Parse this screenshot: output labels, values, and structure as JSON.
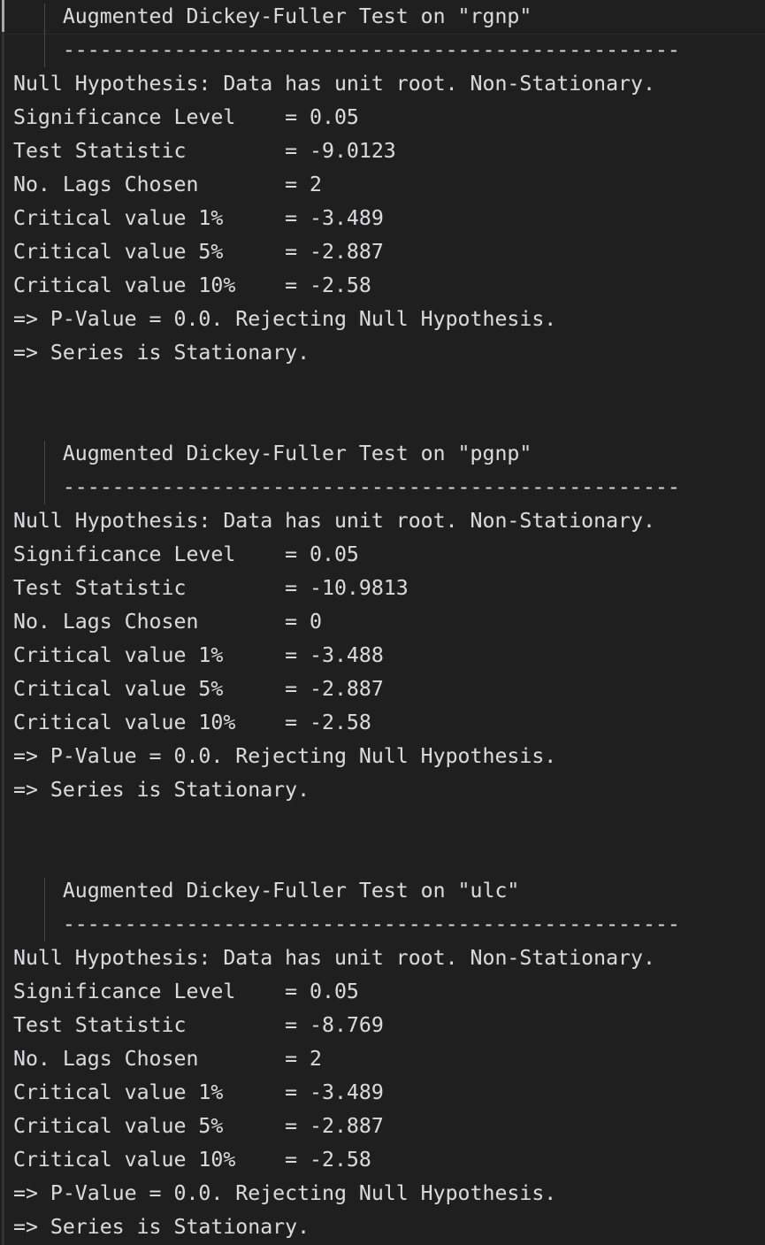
{
  "terminal": {
    "background_color": "#1f1f1f",
    "text_color": "#d9d9d9",
    "gutter_color": "#343434",
    "scrollbar_thumb_color": "#a9a9a9",
    "indent_guide_color": "#4a4a4a",
    "separator_color": "#2b2b2b",
    "divider": "    --------------------------------------------------"
  },
  "tests": [
    {
      "title": "    Augmented Dickey-Fuller Test on \"rgnp\"",
      "divider": "    --------------------------------------------------",
      "null_hypothesis": "Null Hypothesis: Data has unit root. Non-Stationary.",
      "significance_level": "Significance Level    = 0.05",
      "test_statistic": "Test Statistic        = -9.0123",
      "no_lags_chosen": "No. Lags Chosen       = 2",
      "critical_value_1": "Critical value 1%     = -3.489",
      "critical_value_5": "Critical value 5%     = -2.887",
      "critical_value_10": "Critical value 10%    = -2.58",
      "p_value": "=> P-Value = 0.0. Rejecting Null Hypothesis.",
      "conclusion": "=> Series is Stationary."
    },
    {
      "title": "    Augmented Dickey-Fuller Test on \"pgnp\"",
      "divider": "    --------------------------------------------------",
      "null_hypothesis": "Null Hypothesis: Data has unit root. Non-Stationary.",
      "significance_level": "Significance Level    = 0.05",
      "test_statistic": "Test Statistic        = -10.9813",
      "no_lags_chosen": "No. Lags Chosen       = 0",
      "critical_value_1": "Critical value 1%     = -3.488",
      "critical_value_5": "Critical value 5%     = -2.887",
      "critical_value_10": "Critical value 10%    = -2.58",
      "p_value": "=> P-Value = 0.0. Rejecting Null Hypothesis.",
      "conclusion": "=> Series is Stationary."
    },
    {
      "title": "    Augmented Dickey-Fuller Test on \"ulc\"",
      "divider": "    --------------------------------------------------",
      "null_hypothesis": "Null Hypothesis: Data has unit root. Non-Stationary.",
      "significance_level": "Significance Level    = 0.05",
      "test_statistic": "Test Statistic        = -8.769",
      "no_lags_chosen": "No. Lags Chosen       = 2",
      "critical_value_1": "Critical value 1%     = -3.489",
      "critical_value_5": "Critical value 5%     = -2.887",
      "critical_value_10": "Critical value 10%    = -2.58",
      "p_value": "=> P-Value = 0.0. Rejecting Null Hypothesis.",
      "conclusion": "=> Series is Stationary."
    }
  ],
  "lines": [
    "    Augmented Dickey-Fuller Test on \"rgnp\"",
    "    --------------------------------------------------",
    "Null Hypothesis: Data has unit root. Non-Stationary.",
    "Significance Level    = 0.05",
    "Test Statistic        = -9.0123",
    "No. Lags Chosen       = 2",
    "Critical value 1%     = -3.489",
    "Critical value 5%     = -2.887",
    "Critical value 10%    = -2.58",
    "=> P-Value = 0.0. Rejecting Null Hypothesis.",
    "=> Series is Stationary.",
    "",
    "",
    "    Augmented Dickey-Fuller Test on \"pgnp\"",
    "    --------------------------------------------------",
    "Null Hypothesis: Data has unit root. Non-Stationary.",
    "Significance Level    = 0.05",
    "Test Statistic        = -10.9813",
    "No. Lags Chosen       = 0",
    "Critical value 1%     = -3.488",
    "Critical value 5%     = -2.887",
    "Critical value 10%    = -2.58",
    "=> P-Value = 0.0. Rejecting Null Hypothesis.",
    "=> Series is Stationary.",
    "",
    "",
    "    Augmented Dickey-Fuller Test on \"ulc\"",
    "    --------------------------------------------------",
    "Null Hypothesis: Data has unit root. Non-Stationary.",
    "Significance Level    = 0.05",
    "Test Statistic        = -8.769",
    "No. Lags Chosen       = 2",
    "Critical value 1%     = -3.489",
    "Critical value 5%     = -2.887",
    "Critical value 10%    = -2.58",
    "=> P-Value = 0.0. Rejecting Null Hypothesis.",
    "=> Series is Stationary."
  ]
}
